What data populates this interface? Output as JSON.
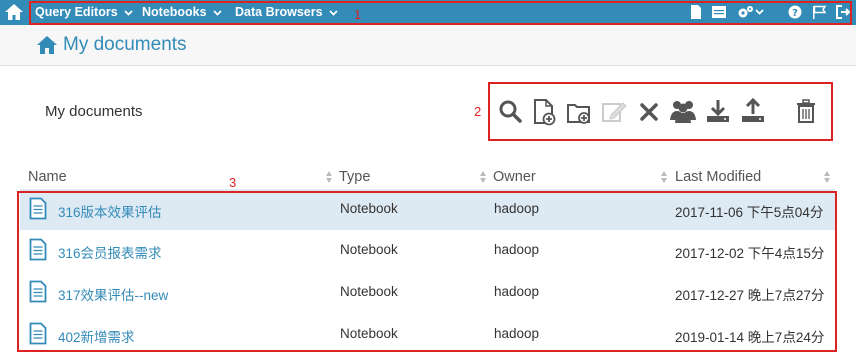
{
  "navbar": {
    "menus": [
      {
        "label": "Query Editors"
      },
      {
        "label": "Notebooks"
      },
      {
        "label": "Data Browsers"
      }
    ],
    "right_icons": [
      "document-icon",
      "table-icon",
      "cogs-icon",
      "help-icon",
      "flag-icon",
      "logout-icon"
    ]
  },
  "page": {
    "title": "My documents"
  },
  "section": {
    "label": "My documents"
  },
  "toolbar": {
    "tools": [
      "search",
      "new-document",
      "new-folder",
      "edit",
      "delete",
      "share",
      "download",
      "upload",
      "trash"
    ]
  },
  "annotations": {
    "box1": "1",
    "box2": "2",
    "box3": "3"
  },
  "table": {
    "headers": {
      "name": "Name",
      "type": "Type",
      "owner": "Owner",
      "modified": "Last Modified"
    },
    "rows": [
      {
        "name": "316版本效果评估",
        "type": "Notebook",
        "owner": "hadoop",
        "modified": "2017-11-06 下午5点04分"
      },
      {
        "name": "316会员报表需求",
        "type": "Notebook",
        "owner": "hadoop",
        "modified": "2017-12-02 下午4点15分"
      },
      {
        "name": "317效果评估--new",
        "type": "Notebook",
        "owner": "hadoop",
        "modified": "2017-12-27 晚上7点27分"
      },
      {
        "name": "402新增需求",
        "type": "Notebook",
        "owner": "hadoop",
        "modified": "2019-01-14 晚上7点24分"
      }
    ]
  },
  "colors": {
    "brand": "#338bb8",
    "selected_row": "#dde9f3",
    "annotation": "#dd2222"
  }
}
